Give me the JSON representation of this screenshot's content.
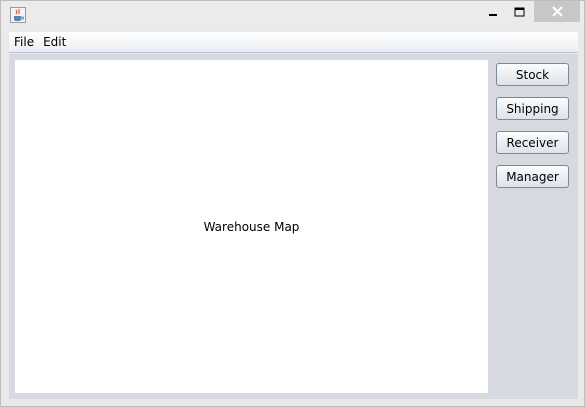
{
  "window": {
    "app_icon": "java-cup-icon",
    "controls": {
      "minimize_icon": "minimize-icon",
      "maximize_icon": "maximize-icon",
      "close_icon": "close-icon"
    }
  },
  "menubar": {
    "items": [
      {
        "label": "File"
      },
      {
        "label": "Edit"
      }
    ]
  },
  "main": {
    "map_label": "Warehouse Map"
  },
  "sidebar": {
    "buttons": [
      {
        "label": "Stock"
      },
      {
        "label": "Shipping"
      },
      {
        "label": "Receiver"
      },
      {
        "label": "Manager"
      }
    ]
  },
  "colors": {
    "content_bg": "#d6d9df",
    "map_bg": "#ffffff",
    "close_button_bg": "#c7c7c7"
  }
}
